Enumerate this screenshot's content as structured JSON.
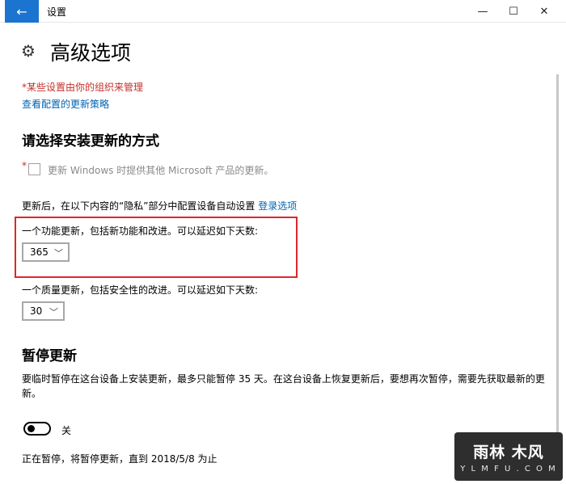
{
  "window": {
    "title": "设置",
    "back_icon": "←",
    "minimize_icon": "—",
    "maximize_icon": "☐",
    "close_icon": "✕"
  },
  "header": {
    "icon": "⚙",
    "title": "高级选项"
  },
  "notices": {
    "managed": "*某些设置由你的组织来管理",
    "policy_link": "查看配置的更新策略"
  },
  "install_section": {
    "title": "请选择安装更新的方式",
    "star": "*",
    "checkbox_label": "更新 Windows 时提供其他 Microsoft 产品的更新。",
    "checkbox_checked": false,
    "info_text": "更新后，在以下内容的“隐私”部分中配置设备自动设置 ",
    "info_link": "登录选项"
  },
  "feature_update": {
    "label": "一个功能更新，包括新功能和改进。可以延迟如下天数:",
    "value": "365",
    "chevron": "﹀"
  },
  "quality_update": {
    "label": "一个质量更新，包括安全性的改进。可以延迟如下天数:",
    "value": "30",
    "chevron": "﹀"
  },
  "pause_section": {
    "title": "暂停更新",
    "description": "要临时暂停在这台设备上安装更新，最多只能暂停 35 天。在这台设备上恢复更新后，要想再次暂停，需要先获取最新的更新。",
    "toggle_on": false,
    "toggle_label": "关",
    "status": "正在暂停，将暂停更新，直到 2018/5/8 为止"
  },
  "watermark": {
    "main": "雨林 木风",
    "sub": "Y L M F U . C O M"
  },
  "colors": {
    "accent": "#1b74d0",
    "link": "#0063b1",
    "managed_red": "#c4302b",
    "highlight_red": "#e0262b"
  }
}
